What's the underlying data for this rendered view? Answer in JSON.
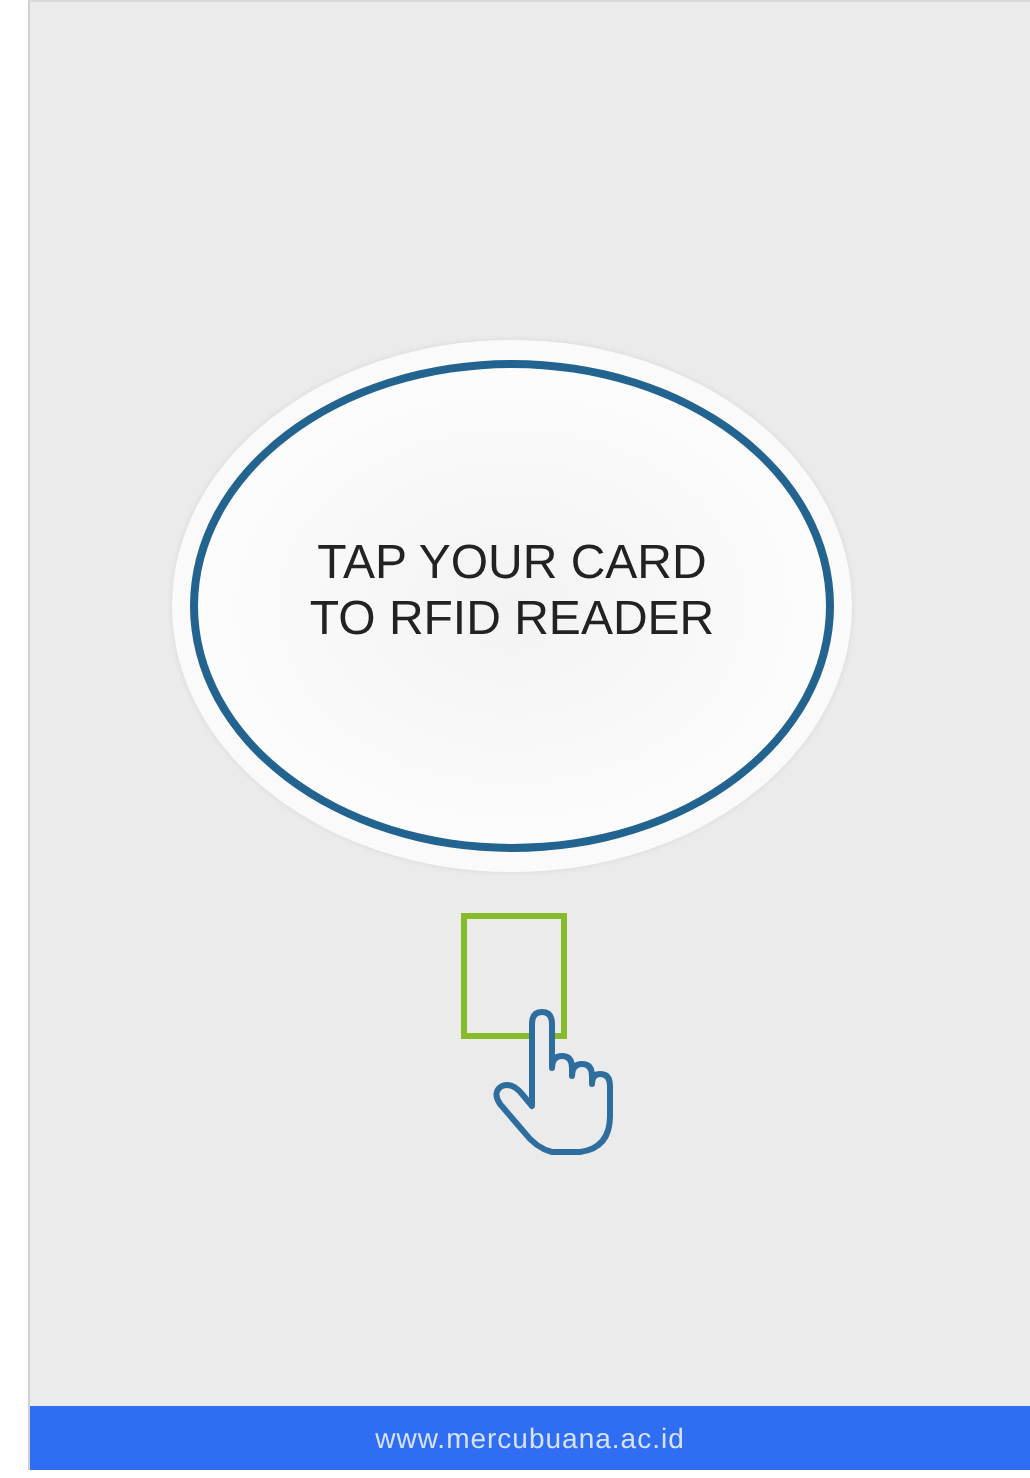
{
  "prompt": {
    "lines": [
      "TAP YOUR CARD",
      "TO RFID READER"
    ]
  },
  "footer": {
    "text": "www.mercubuana.ac.id"
  }
}
